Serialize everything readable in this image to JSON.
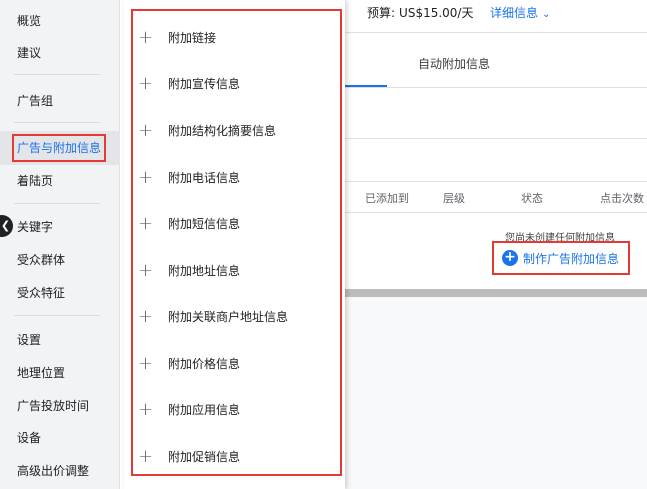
{
  "sidebar": {
    "items": [
      {
        "label": "概览"
      },
      {
        "label": "建议"
      },
      {
        "label": "广告组"
      },
      {
        "label": "广告与附加信息"
      },
      {
        "label": "着陆页"
      },
      {
        "label": "关键字"
      },
      {
        "label": "受众群体"
      },
      {
        "label": "受众特征"
      },
      {
        "label": "设置"
      },
      {
        "label": "地理位置"
      },
      {
        "label": "广告投放时间"
      },
      {
        "label": "设备"
      },
      {
        "label": "高级出价调整"
      }
    ],
    "collapse_icon": "chevron-left-icon"
  },
  "menu": {
    "items": [
      {
        "label": "附加链接"
      },
      {
        "label": "附加宣传信息"
      },
      {
        "label": "附加结构化摘要信息"
      },
      {
        "label": "附加电话信息"
      },
      {
        "label": "附加短信信息"
      },
      {
        "label": "附加地址信息"
      },
      {
        "label": "附加关联商户地址信息"
      },
      {
        "label": "附加价格信息"
      },
      {
        "label": "附加应用信息"
      },
      {
        "label": "附加促销信息"
      }
    ],
    "item_icon": "plus-icon"
  },
  "header": {
    "budget_label": "预算:",
    "budget_value": "US$15.00/天",
    "details_label": "详细信息"
  },
  "tabs": {
    "auto_label": "自动附加信息"
  },
  "table": {
    "columns": [
      "已添加到",
      "层级",
      "状态",
      "点击次数"
    ]
  },
  "empty_state": {
    "message": "您尚未创建任何附加信息",
    "create_label": "制作广告附加信息"
  },
  "colors": {
    "accent": "#1a73e8",
    "highlight_border": "#e53935",
    "sidebar_bg": "#f1f3f4"
  }
}
